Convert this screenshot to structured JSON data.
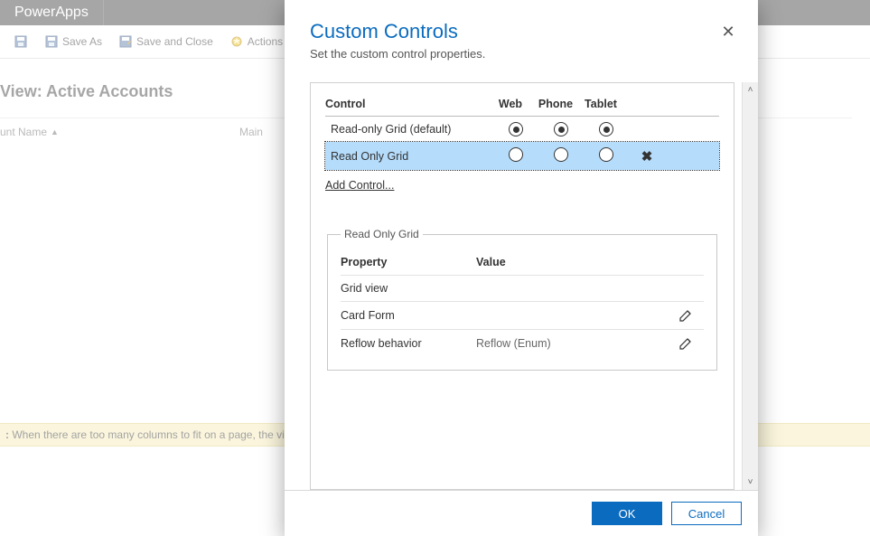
{
  "app": {
    "name": "PowerApps"
  },
  "toolbar": {
    "save_as": "Save As",
    "save_close": "Save and Close",
    "actions": "Actions"
  },
  "view": {
    "title_prefix": "View:",
    "title_name": "Active Accounts",
    "col_account_name": "unt Name",
    "col_main": "Main"
  },
  "notice": {
    "prefix": ":",
    "text": " When there are too many columns to fit on a page, the view "
  },
  "modal": {
    "title": "Custom Controls",
    "subtitle": "Set the custom control properties.",
    "close_glyph": "✕",
    "headers": {
      "control": "Control",
      "web": "Web",
      "phone": "Phone",
      "tablet": "Tablet"
    },
    "rows": [
      {
        "name": "Read-only Grid (default)",
        "web": true,
        "phone": true,
        "tablet": true,
        "selected": false,
        "removable": false
      },
      {
        "name": "Read Only Grid",
        "web": false,
        "phone": false,
        "tablet": false,
        "selected": true,
        "removable": true
      }
    ],
    "add_link": "Add Control...",
    "fieldset_legend": "Read Only Grid",
    "prop_headers": {
      "property": "Property",
      "value": "Value"
    },
    "props": [
      {
        "name": "Grid view",
        "value": "",
        "editable": false
      },
      {
        "name": "Card Form",
        "value": "",
        "editable": true
      },
      {
        "name": "Reflow behavior",
        "value": "Reflow (Enum)",
        "editable": true
      }
    ],
    "footer": {
      "ok": "OK",
      "cancel": "Cancel"
    }
  }
}
